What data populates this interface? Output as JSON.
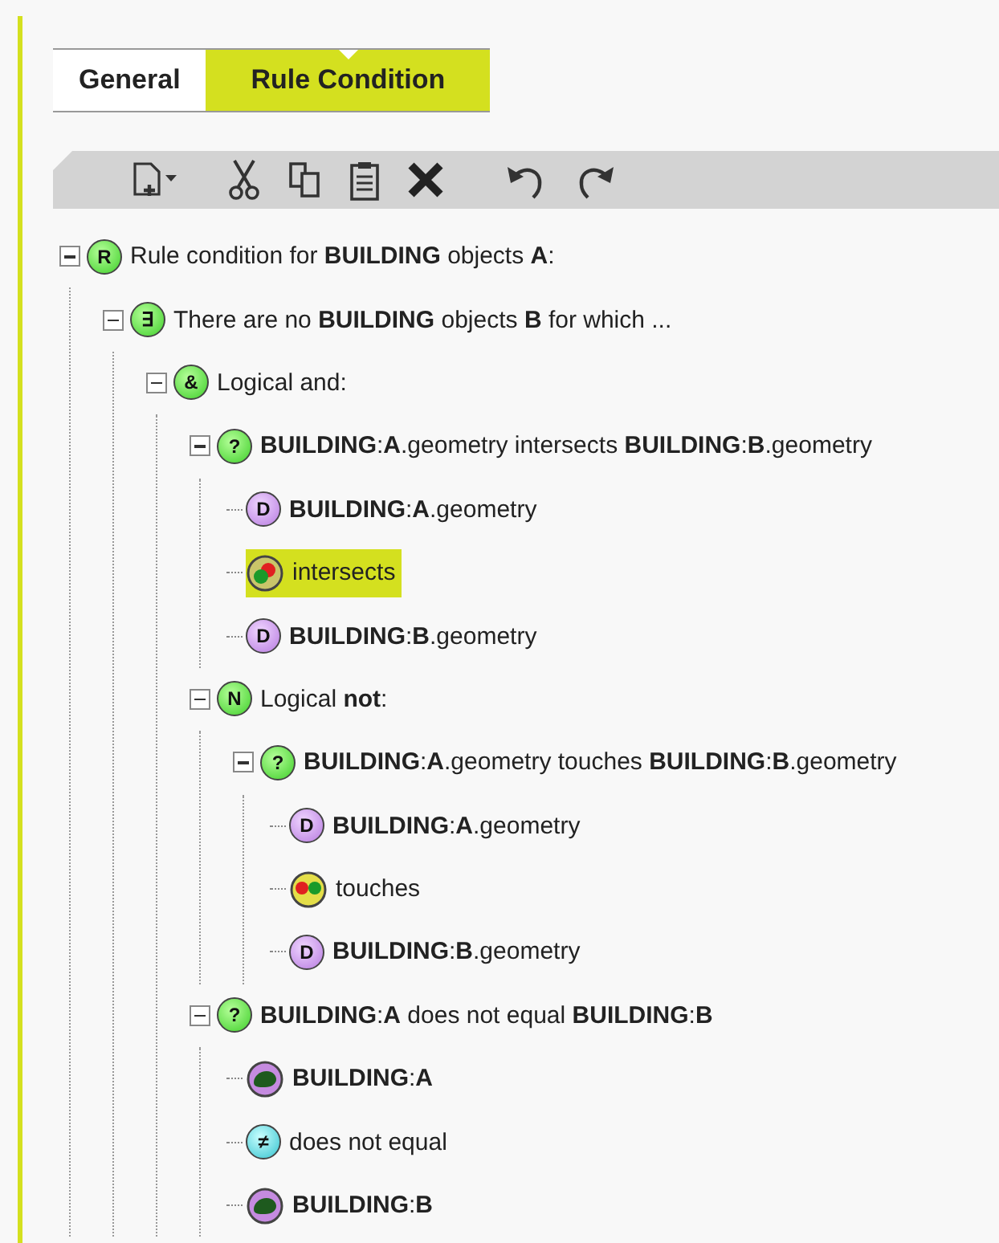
{
  "tabs": [
    {
      "label": "General",
      "selected": false
    },
    {
      "label": "Rule Condition",
      "selected": true
    }
  ],
  "toolbar": [
    {
      "kind": "new"
    },
    {
      "kind": "cut"
    },
    {
      "kind": "copy"
    },
    {
      "kind": "paste"
    },
    {
      "kind": "delete"
    },
    {
      "kind": "undo"
    },
    {
      "kind": "redo"
    }
  ],
  "tree": [
    {
      "kind": "green",
      "badge": "R",
      "label": "Rule condition for **BUILDING** objects **A**:",
      "expanded": true,
      "selected": false,
      "children": [
        {
          "kind": "green",
          "badge": "∃",
          "label": "There are no **BUILDING** objects **B** for which ...",
          "expanded": true,
          "selected": false,
          "children": [
            {
              "kind": "green",
              "badge": "&",
              "label": "Logical and:",
              "expanded": true,
              "selected": false,
              "children": [
                {
                  "kind": "green",
                  "badge": "?",
                  "label": "**BUILDING**:**A**.geometry intersects **BUILDING**:**B**.geometry",
                  "expanded": true,
                  "selected": false,
                  "children": [
                    {
                      "kind": "purple",
                      "badge": "D",
                      "label": "**BUILDING**:**A**.geometry",
                      "selected": false
                    },
                    {
                      "kind": "intersects",
                      "label": "intersects",
                      "selected": true
                    },
                    {
                      "kind": "purple",
                      "badge": "D",
                      "label": "**BUILDING**:**B**.geometry",
                      "selected": false
                    }
                  ]
                },
                {
                  "kind": "green",
                  "badge": "N",
                  "label": "Logical **not**:",
                  "expanded": true,
                  "selected": false,
                  "children": [
                    {
                      "kind": "green",
                      "badge": "?",
                      "label": "**BUILDING**:**A**.geometry touches **BUILDING**:**B**.geometry",
                      "expanded": true,
                      "selected": false,
                      "children": [
                        {
                          "kind": "purple",
                          "badge": "D",
                          "label": "**BUILDING**:**A**.geometry",
                          "selected": false
                        },
                        {
                          "kind": "touches",
                          "label": "touches",
                          "selected": false
                        },
                        {
                          "kind": "purple",
                          "badge": "D",
                          "label": "**BUILDING**:**B**.geometry",
                          "selected": false
                        }
                      ]
                    }
                  ]
                },
                {
                  "kind": "green",
                  "badge": "?",
                  "label": "**BUILDING**:**A** does not equal **BUILDING**:**B**",
                  "expanded": true,
                  "selected": false,
                  "children": [
                    {
                      "kind": "shape",
                      "label": "**BUILDING**:**A**",
                      "selected": false
                    },
                    {
                      "kind": "cyan",
                      "badge": "≠",
                      "label": "does not equal",
                      "selected": false
                    },
                    {
                      "kind": "shape",
                      "label": "**BUILDING**:**B**",
                      "selected": false
                    }
                  ]
                }
              ]
            }
          ]
        }
      ]
    }
  ]
}
